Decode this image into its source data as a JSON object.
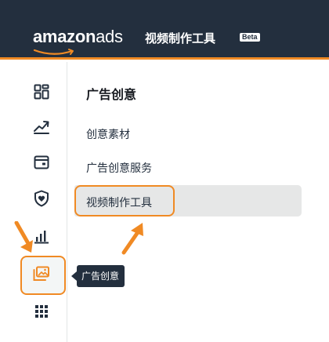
{
  "header": {
    "logo_amazon": "amazon",
    "logo_ads": "ads",
    "tool_title": "视频制作工具",
    "badge": "Beta"
  },
  "sidebar": {
    "items": [
      {
        "icon": "dashboard-grid-icon",
        "active": false
      },
      {
        "icon": "trend-chart-icon",
        "active": false
      },
      {
        "icon": "wallet-icon",
        "active": false
      },
      {
        "icon": "shield-heart-icon",
        "active": false
      },
      {
        "icon": "bar-chart-icon",
        "active": false
      },
      {
        "icon": "creative-images-icon",
        "active": true
      },
      {
        "icon": "apps-grid-icon",
        "active": false
      }
    ],
    "tooltip": "广告创意"
  },
  "panel": {
    "title": "广告创意",
    "items": [
      {
        "label": "创意素材",
        "selected": false
      },
      {
        "label": "广告创意服务",
        "selected": false
      },
      {
        "label": "视频制作工具",
        "selected": true
      }
    ]
  },
  "colors": {
    "header_bg": "#232f3e",
    "accent_orange": "#f08a24",
    "selected_bg": "#e6e7e7",
    "text": "#232f3e"
  }
}
